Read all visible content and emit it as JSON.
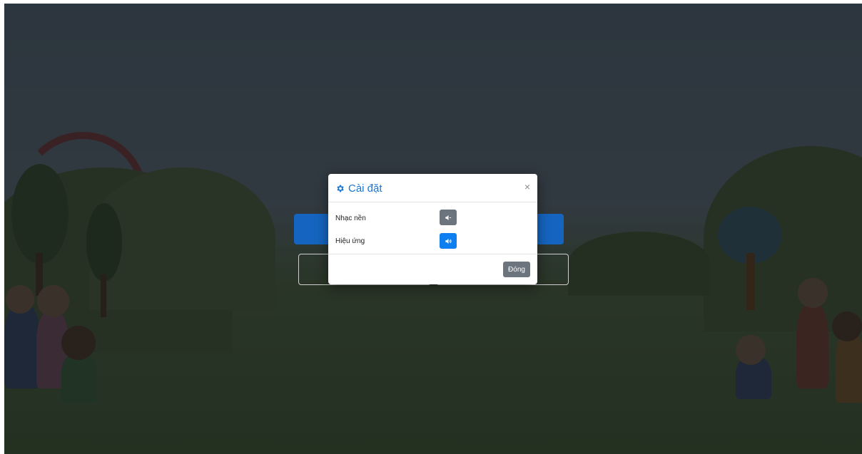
{
  "modal": {
    "title": "Cài đặt",
    "title_icon": "gear-icon",
    "close_icon": "close-icon",
    "close_glyph": "×",
    "rows": [
      {
        "label": "Nhạc nền",
        "icon": "volume-mute-icon",
        "state": "off",
        "color": "#6c757d"
      },
      {
        "label": "Hiệu ứng",
        "icon": "volume-up-icon",
        "state": "on",
        "color": "#0d7ff0"
      }
    ],
    "close_button_label": "Đóng",
    "accent_color": "#1976d2"
  }
}
